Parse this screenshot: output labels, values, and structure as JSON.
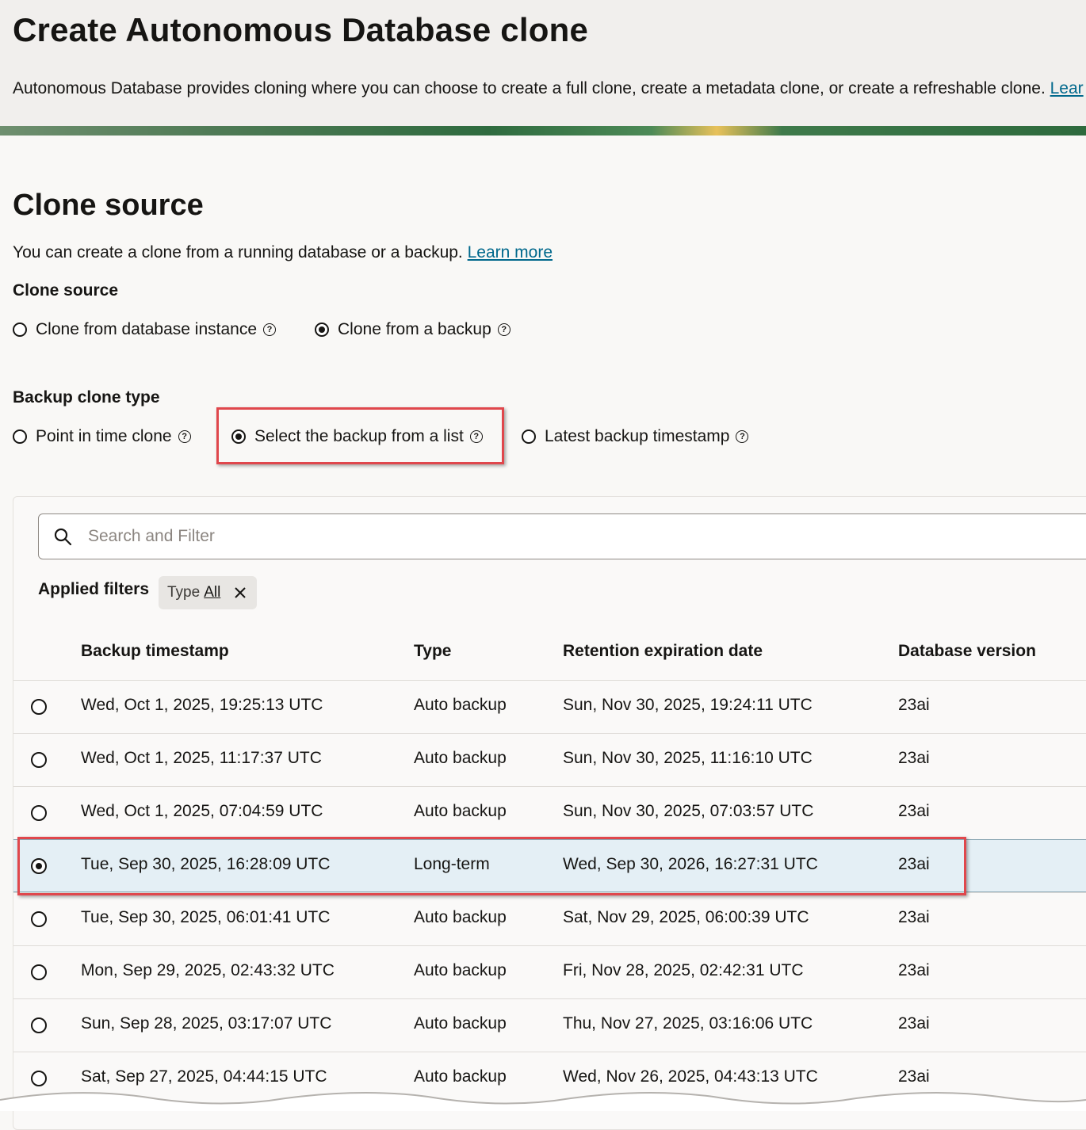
{
  "header": {
    "title": "Create Autonomous Database clone",
    "description": "Autonomous Database provides cloning where you can choose to create a full clone, create a metadata clone, or create a refreshable clone.",
    "learn_link": "Lear"
  },
  "clone_source": {
    "title": "Clone source",
    "description": "You can create a clone from a running database or a backup.",
    "learn_more": "Learn more",
    "label": "Clone source",
    "options": [
      {
        "label": "Clone from database instance",
        "checked": false
      },
      {
        "label": "Clone from a backup",
        "checked": true
      }
    ]
  },
  "backup_clone_type": {
    "label": "Backup clone type",
    "options": [
      {
        "label": "Point in time clone",
        "checked": false
      },
      {
        "label": "Select the backup from a list",
        "checked": true
      },
      {
        "label": "Latest backup timestamp",
        "checked": false
      }
    ]
  },
  "search": {
    "placeholder": "Search and Filter"
  },
  "filters": {
    "label": "Applied filters",
    "chip": {
      "key": "Type",
      "value": "All"
    }
  },
  "table": {
    "columns": [
      "Backup timestamp",
      "Type",
      "Retention expiration date",
      "Database version"
    ],
    "rows": [
      {
        "timestamp": "Wed, Oct 1, 2025, 19:25:13 UTC",
        "type": "Auto backup",
        "retention": "Sun, Nov 30, 2025, 19:24:11 UTC",
        "version": "23ai",
        "selected": false
      },
      {
        "timestamp": "Wed, Oct 1, 2025, 11:17:37 UTC",
        "type": "Auto backup",
        "retention": "Sun, Nov 30, 2025, 11:16:10 UTC",
        "version": "23ai",
        "selected": false
      },
      {
        "timestamp": "Wed, Oct 1, 2025, 07:04:59 UTC",
        "type": "Auto backup",
        "retention": "Sun, Nov 30, 2025, 07:03:57 UTC",
        "version": "23ai",
        "selected": false
      },
      {
        "timestamp": "Tue, Sep 30, 2025, 16:28:09 UTC",
        "type": "Long-term",
        "retention": "Wed, Sep 30, 2026, 16:27:31 UTC",
        "version": "23ai",
        "selected": true
      },
      {
        "timestamp": "Tue, Sep 30, 2025, 06:01:41 UTC",
        "type": "Auto backup",
        "retention": "Sat, Nov 29, 2025, 06:00:39 UTC",
        "version": "23ai",
        "selected": false
      },
      {
        "timestamp": "Mon, Sep 29, 2025, 02:43:32 UTC",
        "type": "Auto backup",
        "retention": "Fri, Nov 28, 2025, 02:42:31 UTC",
        "version": "23ai",
        "selected": false
      },
      {
        "timestamp": "Sun, Sep 28, 2025, 03:17:07 UTC",
        "type": "Auto backup",
        "retention": "Thu, Nov 27, 2025, 03:16:06 UTC",
        "version": "23ai",
        "selected": false
      },
      {
        "timestamp": "Sat, Sep 27, 2025, 04:44:15 UTC",
        "type": "Auto backup",
        "retention": "Wed, Nov 26, 2025, 04:43:13 UTC",
        "version": "23ai",
        "selected": false
      }
    ]
  },
  "colors": {
    "accent_link": "#00688c",
    "highlight": "#e0474c",
    "selected_row": "#e4eff5"
  }
}
